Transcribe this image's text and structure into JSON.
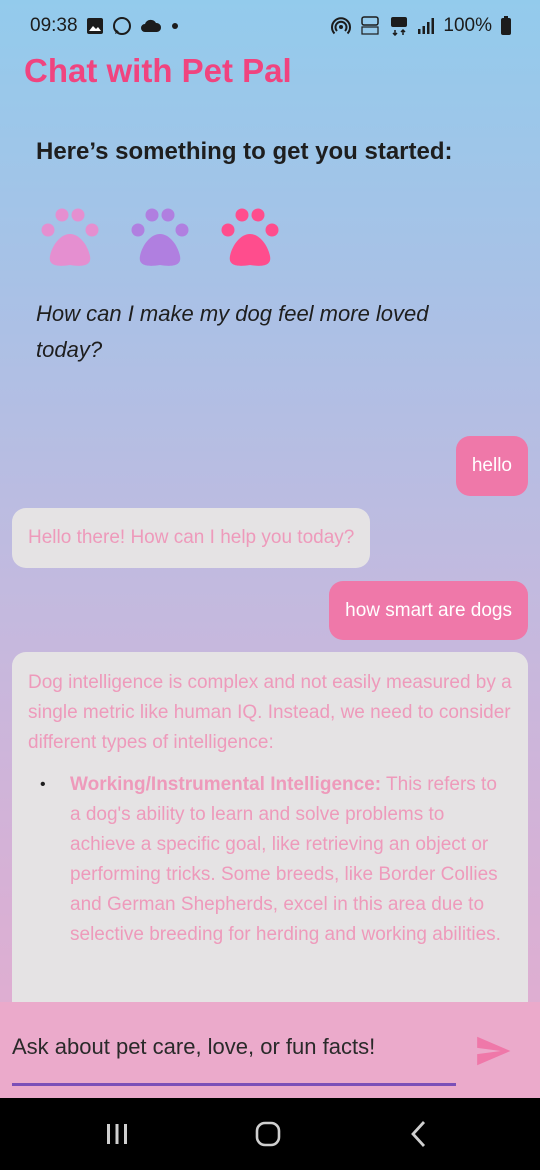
{
  "status_bar": {
    "time": "09:38",
    "battery": "100%",
    "icons_left": [
      "gallery-icon",
      "whatsapp-icon",
      "cloud-icon",
      "dot-icon"
    ],
    "icons_right": [
      "hotspot-icon",
      "volte-icon",
      "5g-icon",
      "signal-icon",
      "battery-icon"
    ]
  },
  "header": {
    "title": "Chat with Pet Pal"
  },
  "starter": {
    "heading": "Here’s something to get you started:",
    "paw_colors": [
      "#e58fd0",
      "#b07fe0",
      "#ff4d8d"
    ],
    "question": "How can I make my dog feel more loved today?"
  },
  "messages": [
    {
      "role": "user",
      "text": "hello"
    },
    {
      "role": "bot",
      "text": "Hello there! How can I help you today?"
    },
    {
      "role": "user",
      "text": "how smart are dogs"
    },
    {
      "role": "bot",
      "intro": "Dog intelligence is complex and not easily measured by a single metric like human IQ. Instead, we need to consider different types of intelligence:",
      "bullets": [
        {
          "marker": "•",
          "title": "Working/Instrumental Intelligence:",
          "text": " This refers to a dog's ability to learn and solve problems to achieve a specific goal, like retrieving an object or performing tricks. Some breeds, like Border Collies and German Shepherds, excel in this area due to selective breeding for herding and working abilities."
        }
      ]
    }
  ],
  "input": {
    "placeholder": "Ask about pet care, love, or fun facts!"
  },
  "colors": {
    "accent": "#f0447f",
    "user_bubble": "#ef78a9",
    "bot_bubble": "#e5e3e4",
    "bot_text": "#ee9abb",
    "input_underline": "#7b4fb8",
    "send_icon": "#ef78a9"
  }
}
